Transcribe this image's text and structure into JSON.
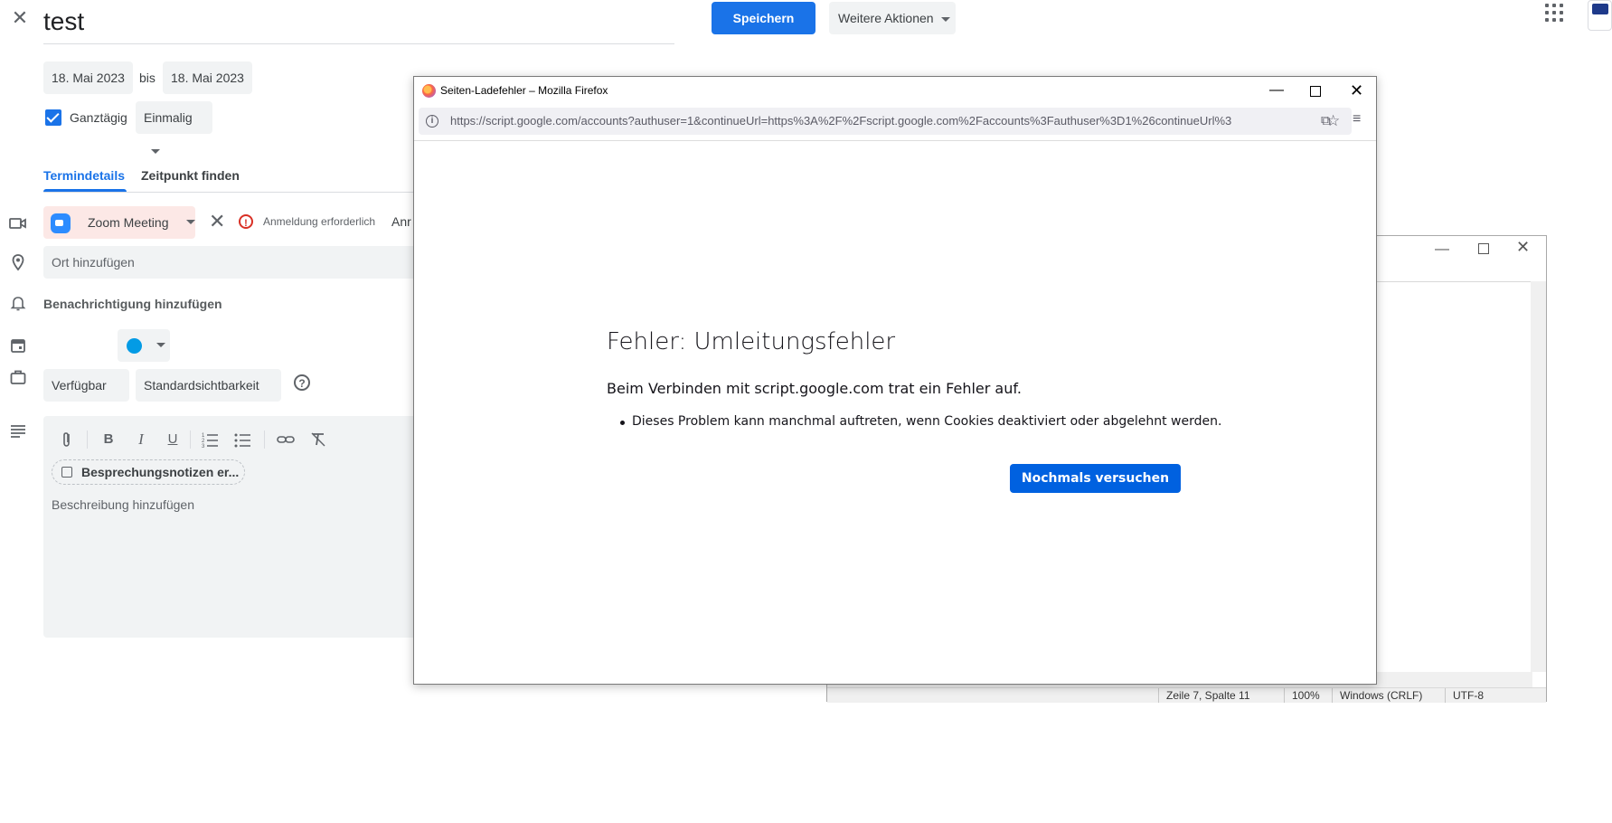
{
  "calendar": {
    "title": "test",
    "save_label": "Speichern",
    "more_actions_label": "Weitere Aktionen",
    "start_date": "18. Mai 2023",
    "to_label": "bis",
    "end_date": "18. Mai 2023",
    "allday_label": "Ganztägig",
    "allday_checked": true,
    "repeat_value": "Einmalig",
    "tabs": [
      {
        "label": "Termindetails",
        "active": true
      },
      {
        "label": "Zeitpunkt finden",
        "active": false
      }
    ],
    "conference_label": "Zoom Meeting",
    "login_required_label": "Anmeldung erforderlich",
    "truncated_text": "Anr",
    "location_placeholder": "Ort hinzufügen",
    "notification_label": "Benachrichtigung hinzufügen",
    "event_color": "#039be5",
    "availability_value": "Verfügbar",
    "visibility_value": "Standardsichtbarkeit",
    "notes_chip_label": "Besprechungsnotizen er...",
    "description_placeholder": "Beschreibung hinzufügen",
    "accent_color": "#1a73e8"
  },
  "notepad": {
    "status_position": "Zeile 7, Spalte 11",
    "status_zoom": "100%",
    "status_line_endings": "Windows (CRLF)",
    "status_encoding": "UTF-8"
  },
  "firefox": {
    "window_title": "Seiten-Ladefehler – Mozilla Firefox",
    "url": "https://script.google.com/accounts?authuser=1&continueUrl=https%3A%2F%2Fscript.google.com%2Faccounts%3Fauthuser%3D1%26continueUrl%3",
    "error_title": "Fehler: Umleitungsfehler",
    "error_subtitle": "Beim Verbinden mit script.google.com trat ein Fehler auf.",
    "error_bullet": "Dieses Problem kann manchmal auftreten, wenn Cookies deaktiviert oder abgelehnt werden.",
    "retry_label": "Nochmals versuchen",
    "retry_color": "#0061e0"
  }
}
